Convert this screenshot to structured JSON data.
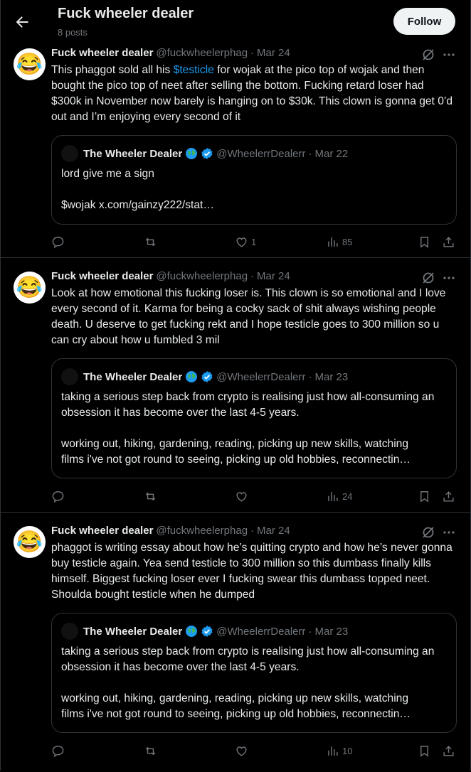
{
  "header": {
    "title": "Fuck wheeler dealer",
    "post_count": "8 posts",
    "follow_label": "Follow"
  },
  "posts": [
    {
      "name": "Fuck wheeler dealer",
      "handle": "@fuckwheelerphag",
      "date": "Mar 24",
      "text_before": "This phaggot sold all his ",
      "cashtag": "$testicle",
      "text_after": " for wojak at the pico top of wojak and then bought the pico top of neet after selling the bottom. Fucking retard loser had $300k in November now barely is hanging on to $30k. This clown is gonna get 0’d out and I’m enjoying every second of it",
      "quote": {
        "name": "The Wheeler Dealer",
        "handle": "@WheelerrDealerr",
        "date": "Mar 22",
        "para1": "lord give me a sign",
        "para2": "$wojak x.com/gainzy222/stat…"
      },
      "stats": {
        "likes": "1",
        "views": "85"
      }
    },
    {
      "name": "Fuck wheeler dealer",
      "handle": "@fuckwheelerphag",
      "date": "Mar 24",
      "text": "Look at how emotional this fucking loser is. This clown is so emotional and I love every second of it. Karma for being a cocky sack of shit always wishing people death. U deserve to get fucking rekt and I hope testicle goes to 300 million so u can cry about how u fumbled 3 mil",
      "quote": {
        "name": "The Wheeler Dealer",
        "handle": "@WheelerrDealerr",
        "date": "Mar 23",
        "para1": "taking a serious step back from crypto is realising just how all-consuming an obsession it has become over the last 4-5 years.",
        "para2_line1": "working out, hiking, gardening, reading, picking up new skills, watching",
        "para2_line2": "films i've not got round to seeing, picking up old hobbies, reconnectin…"
      },
      "stats": {
        "likes": "",
        "views": "24"
      }
    },
    {
      "name": "Fuck wheeler dealer",
      "handle": "@fuckwheelerphag",
      "date": "Mar 24",
      "text": "phaggot is writing essay about how he’s quitting crypto and how he’s never gonna buy testicle again. Yea send testicle to 300 million so this dumbass finally kills himself. Biggest fucking loser ever I fucking swear this dumbass topped neet. Shoulda bought testicle when he dumped",
      "quote": {
        "name": "The Wheeler Dealer",
        "handle": "@WheelerrDealerr",
        "date": "Mar 23",
        "para1": "taking a serious step back from crypto is realising just how all-consuming an obsession it has become over the last 4-5 years.",
        "para2_line1": "working out, hiking, gardening, reading, picking up new skills, watching",
        "para2_line2": "films i've not got round to seeing, picking up old hobbies, reconnectin…"
      },
      "stats": {
        "likes": "",
        "views": "10"
      }
    }
  ],
  "avatar_emoji": "😂",
  "colors": {
    "background": "#000000",
    "text": "#e7e9ea",
    "muted": "#71767b",
    "accent": "#1d9bf0",
    "border": "#2f3336"
  }
}
